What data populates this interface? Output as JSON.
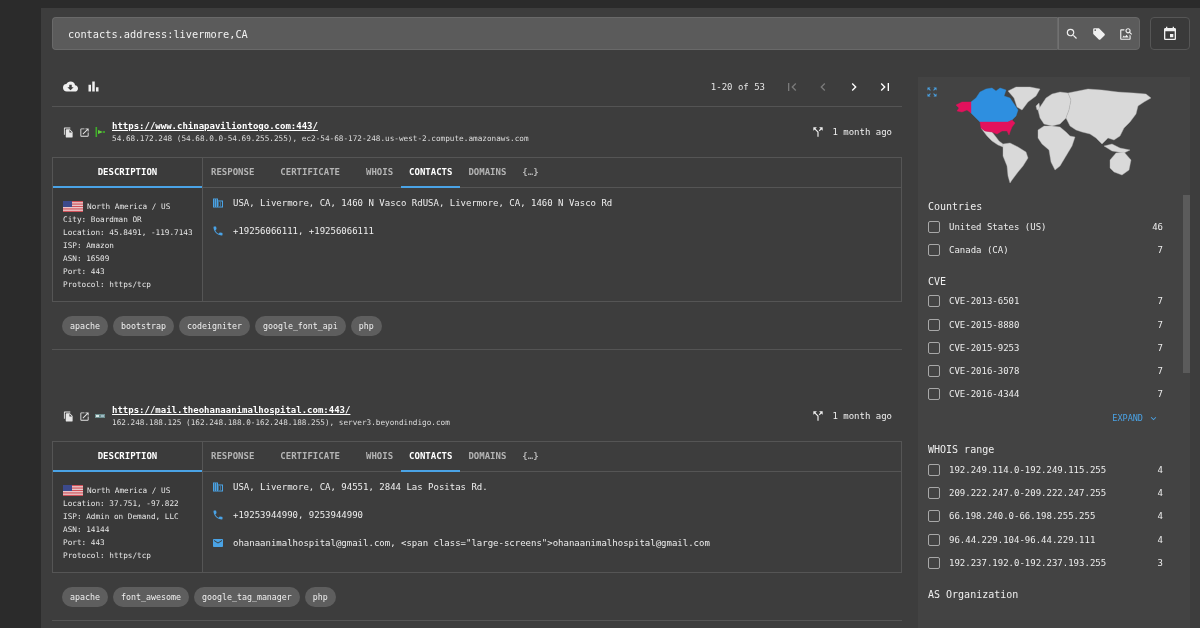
{
  "search": {
    "value": "contacts.address:livermore,CA"
  },
  "pagination": {
    "range": "1-20 of 53",
    "buttons": [
      {
        "kind": "first",
        "disabled": true
      },
      {
        "kind": "prev",
        "disabled": true
      },
      {
        "kind": "next",
        "disabled": false
      },
      {
        "kind": "last",
        "disabled": false
      }
    ]
  },
  "results": [
    {
      "kind": "arrow",
      "url": "https://www.chinapaviliontogo.com:443/",
      "host_info": "54.68.172.248 (54.68.0.0-54.69.255.255), ec2-54-68-172-248.us-west-2.compute.amazonaws.com",
      "last_seen": "1 month ago",
      "description_tab": {
        "label": "DESCRIPTION",
        "selected": true
      },
      "tabs": [
        {
          "label": "RESPONSE",
          "selected": false
        },
        {
          "label": "CERTIFICATE",
          "selected": false
        },
        {
          "label": "WHOIS",
          "selected": false
        },
        {
          "label": "CONTACTS",
          "selected": true
        },
        {
          "label": "DOMAINS",
          "selected": false
        },
        {
          "label": "{…}",
          "selected": false
        }
      ],
      "description": {
        "region": "North America / US",
        "lines": [
          "City: Boardman OR",
          "Location: 45.8491, -119.7143",
          "ISP: Amazon",
          "ASN: 16509",
          "Port: 443",
          "Protocol: https/tcp"
        ]
      },
      "contacts": [
        {
          "kind": "address",
          "text": "USA, Livermore, CA, 1460 N Vasco RdUSA, Livermore, CA, 1460 N Vasco Rd"
        },
        {
          "kind": "phone",
          "text": "+19256066111, +19256066111"
        }
      ],
      "tags": [
        "apache",
        "bootstrap",
        "codeigniter",
        "google_font_api",
        "php"
      ]
    },
    {
      "kind": "banner",
      "url": "https://mail.theohanaanimalhospital.com:443/",
      "host_info": "162.248.188.125 (162.248.188.0-162.248.188.255), server3.beyondindigo.com",
      "last_seen": "1 month ago",
      "description_tab": {
        "label": "DESCRIPTION",
        "selected": true
      },
      "tabs": [
        {
          "label": "RESPONSE",
          "selected": false
        },
        {
          "label": "CERTIFICATE",
          "selected": false
        },
        {
          "label": "WHOIS",
          "selected": false
        },
        {
          "label": "CONTACTS",
          "selected": true
        },
        {
          "label": "DOMAINS",
          "selected": false
        },
        {
          "label": "{…}",
          "selected": false
        }
      ],
      "description": {
        "region": "North America / US",
        "lines": [
          "Location: 37.751, -97.822",
          "ISP: Admin on Demand, LLC",
          "ASN: 14144",
          "Port: 443",
          "Protocol: https/tcp"
        ]
      },
      "contacts": [
        {
          "kind": "address",
          "text": "USA, Livermore, CA, 94551, 2844 Las Positas Rd."
        },
        {
          "kind": "phone",
          "text": "+19253944990, 9253944990"
        },
        {
          "kind": "email",
          "text": "ohanaanimalhospital@gmail.com, <span class=\"large-screens\">ohanaanimalhospital@gmail.com"
        }
      ],
      "tags": [
        "apache",
        "font_awesome",
        "google_tag_manager",
        "php"
      ]
    }
  ],
  "sidebar": {
    "facets": [
      {
        "title": "Countries",
        "items": [
          {
            "label": "United States (US)",
            "count": "46",
            "checked": false
          },
          {
            "label": "Canada (CA)",
            "count": "7",
            "checked": false
          }
        ]
      },
      {
        "title": "CVE",
        "items": [
          {
            "label": "CVE-2013-6501",
            "count": "7",
            "checked": false
          },
          {
            "label": "CVE-2015-8880",
            "count": "7",
            "checked": false
          },
          {
            "label": "CVE-2015-9253",
            "count": "7",
            "checked": false
          },
          {
            "label": "CVE-2016-3078",
            "count": "7",
            "checked": false
          },
          {
            "label": "CVE-2016-4344",
            "count": "7",
            "checked": false
          }
        ],
        "expand": "EXPAND"
      },
      {
        "title": "WHOIS range",
        "items": [
          {
            "label": "192.249.114.0-192.249.115.255",
            "count": "4",
            "checked": false
          },
          {
            "label": "209.222.247.0-209.222.247.255",
            "count": "4",
            "checked": false
          },
          {
            "label": "66.198.240.0-66.198.255.255",
            "count": "4",
            "checked": false
          },
          {
            "label": "96.44.229.104-96.44.229.111",
            "count": "4",
            "checked": false
          },
          {
            "label": "192.237.192.0-192.237.193.255",
            "count": "3",
            "checked": false
          }
        ]
      },
      {
        "title": "AS Organization"
      }
    ]
  }
}
